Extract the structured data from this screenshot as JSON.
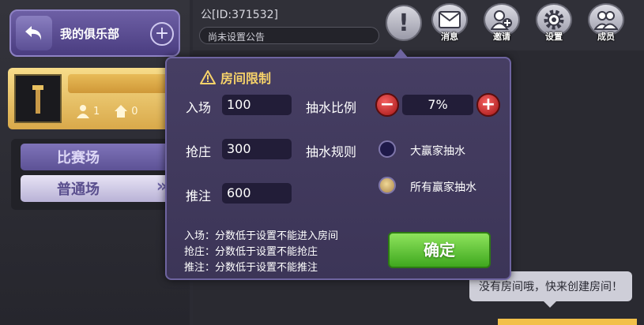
{
  "sidebar": {
    "club_title": "我的俱乐部",
    "card": {
      "members": "1",
      "rooms": "0"
    },
    "tabs": [
      {
        "label": "比赛场"
      },
      {
        "label": "普通场",
        "arrow": "»"
      }
    ]
  },
  "topbar": {
    "club_id": "公[ID:371532]",
    "notice": "尚未设置公告",
    "info_glyph": "!",
    "icons": [
      {
        "name": "mail-icon",
        "label": "消息"
      },
      {
        "name": "invite-icon",
        "label": "邀请"
      },
      {
        "name": "gear-icon",
        "label": "设置"
      },
      {
        "name": "members-icon",
        "label": "成员"
      }
    ]
  },
  "modal": {
    "title": "房间限制",
    "rows": [
      {
        "label": "入场",
        "value": "100"
      },
      {
        "label": "抢庄",
        "value": "300"
      },
      {
        "label": "推注",
        "value": "600"
      }
    ],
    "rake_ratio_label": "抽水比例",
    "rake_ratio_value": "7%",
    "rake_rule_label": "抽水规则",
    "rule_options": [
      {
        "label": "大赢家抽水",
        "selected": false
      },
      {
        "label": "所有赢家抽水",
        "selected": true
      }
    ],
    "rules_text": [
      "入场：分数低于设置不能进入房间",
      "抢庄：分数低于设置不能抢庄",
      "推注：分数低于设置不能推注"
    ],
    "confirm_label": "确定"
  },
  "empty_hint": "没有房间哦，快来创建房间！",
  "colors": {
    "accent_gold": "#f7d36a",
    "confirm_green": "#5cc737",
    "panel_purple": "#463e63"
  }
}
